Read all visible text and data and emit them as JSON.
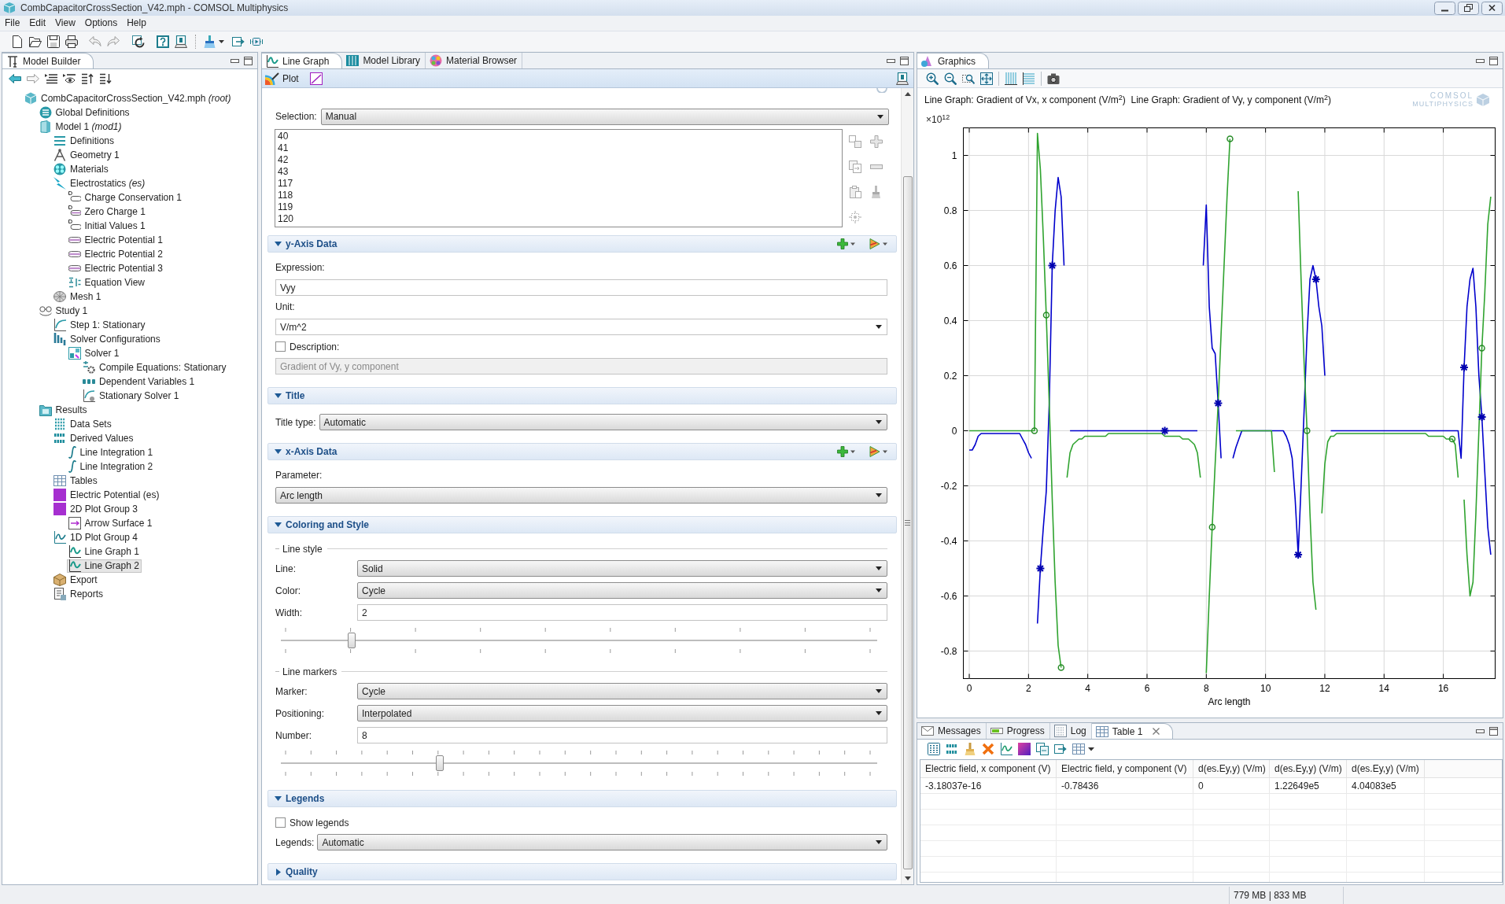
{
  "window": {
    "title": "CombCapacitorCrossSection_V42.mph - COMSOL Multiphysics"
  },
  "menu": [
    "File",
    "Edit",
    "View",
    "Options",
    "Help"
  ],
  "model_builder": {
    "tab": "Model Builder",
    "tree": [
      {
        "label": "CombCapacitorCrossSection_V42.mph *(root)*",
        "kind": "root",
        "selected": false,
        "children": [
          {
            "label": "Global Definitions",
            "kind": "global",
            "selected": false
          },
          {
            "label": "Model 1 *(mod1)*",
            "kind": "model",
            "selected": false,
            "children": [
              {
                "label": "Definitions",
                "kind": "definitions",
                "selected": false
              },
              {
                "label": "Geometry 1",
                "kind": "geometry",
                "selected": false
              },
              {
                "label": "Materials",
                "kind": "materials",
                "selected": false
              },
              {
                "label": "Electrostatics *(es)*",
                "kind": "physics",
                "selected": false,
                "children": [
                  {
                    "label": "Charge Conservation 1",
                    "kind": "feature",
                    "selected": false
                  },
                  {
                    "label": "Zero Charge 1",
                    "kind": "boundary",
                    "selected": false
                  },
                  {
                    "label": "Initial Values 1",
                    "kind": "feature",
                    "selected": false
                  },
                  {
                    "label": "Electric Potential 1",
                    "kind": "potential",
                    "selected": false
                  },
                  {
                    "label": "Electric Potential 2",
                    "kind": "potential",
                    "selected": false
                  },
                  {
                    "label": "Electric Potential 3",
                    "kind": "potential",
                    "selected": false
                  },
                  {
                    "label": "Equation View",
                    "kind": "equation",
                    "selected": false
                  }
                ]
              },
              {
                "label": "Mesh 1",
                "kind": "mesh",
                "selected": false
              }
            ]
          },
          {
            "label": "Study 1",
            "kind": "study",
            "selected": false,
            "children": [
              {
                "label": "Step 1: Stationary",
                "kind": "step",
                "selected": false
              },
              {
                "label": "Solver Configurations",
                "kind": "solvers",
                "selected": false,
                "children": [
                  {
                    "label": "Solver 1",
                    "kind": "solver",
                    "selected": false,
                    "children": [
                      {
                        "label": "Compile Equations: Stationary",
                        "kind": "compile",
                        "selected": false
                      },
                      {
                        "label": "Dependent Variables 1",
                        "kind": "variables",
                        "selected": false
                      },
                      {
                        "label": "Stationary Solver 1",
                        "kind": "stationary",
                        "selected": false
                      }
                    ]
                  }
                ]
              }
            ]
          },
          {
            "label": "Results",
            "kind": "results",
            "selected": false,
            "children": [
              {
                "label": "Data Sets",
                "kind": "datasets",
                "selected": false
              },
              {
                "label": "Derived Values",
                "kind": "derived",
                "selected": false,
                "children": [
                  {
                    "label": "Line Integration 1",
                    "kind": "integration",
                    "selected": false
                  },
                  {
                    "label": "Line Integration 2",
                    "kind": "integration",
                    "selected": false
                  }
                ]
              },
              {
                "label": "Tables",
                "kind": "tables",
                "selected": false
              },
              {
                "label": "Electric Potential (es)",
                "kind": "plot2d",
                "selected": false
              },
              {
                "label": "2D Plot Group 3",
                "kind": "plot2d",
                "selected": false,
                "children": [
                  {
                    "label": "Arrow Surface 1",
                    "kind": "arrow",
                    "selected": false
                  }
                ]
              },
              {
                "label": "1D Plot Group 4",
                "kind": "plot1d",
                "selected": false,
                "children": [
                  {
                    "label": "Line Graph 1",
                    "kind": "linegraph",
                    "selected": false
                  },
                  {
                    "label": "Line Graph 2",
                    "kind": "linegraph",
                    "selected": true
                  }
                ]
              },
              {
                "label": "Export",
                "kind": "export",
                "selected": false
              },
              {
                "label": "Reports",
                "kind": "reports",
                "selected": false
              }
            ]
          }
        ]
      }
    ]
  },
  "settings": {
    "tabs": [
      {
        "label": "Line Graph",
        "kind": "linegraph",
        "selected": true
      },
      {
        "label": "Model Library",
        "kind": "library",
        "selected": false
      },
      {
        "label": "Material Browser",
        "kind": "materials",
        "selected": false
      }
    ],
    "plot_button": "Plot",
    "selection": {
      "label": "Selection:",
      "value": "Manual",
      "items": [
        "40",
        "41",
        "42",
        "43",
        "117",
        "118",
        "119",
        "120"
      ]
    },
    "sections": [
      {
        "title": "y-Axis Data",
        "expanded": true,
        "actions": true,
        "rows": [
          {
            "kind": "label",
            "text": "Expression:"
          },
          {
            "kind": "input",
            "value": "Vyy",
            "disabled": false
          },
          {
            "kind": "label",
            "text": "Unit:"
          },
          {
            "kind": "combo",
            "value": "V/m^2"
          },
          {
            "kind": "checkbox",
            "label": "Description:",
            "checked": false
          },
          {
            "kind": "input",
            "value": "Gradient of Vy, y component",
            "disabled": true
          }
        ]
      },
      {
        "title": "Title",
        "expanded": true,
        "actions": false,
        "rows": [
          {
            "kind": "select",
            "label": "Title type:",
            "value": "Automatic"
          }
        ]
      },
      {
        "title": "x-Axis Data",
        "expanded": true,
        "actions": true,
        "rows": [
          {
            "kind": "label",
            "text": "Parameter:"
          },
          {
            "kind": "select",
            "value": "Arc length"
          }
        ]
      },
      {
        "title": "Coloring and Style",
        "expanded": true,
        "actions": false,
        "rows": [
          {
            "kind": "group",
            "label": "Line style"
          },
          {
            "kind": "form-select",
            "label": "Line:",
            "value": "Solid"
          },
          {
            "kind": "form-select",
            "label": "Color:",
            "value": "Cycle"
          },
          {
            "kind": "form-input",
            "label": "Width:",
            "value": "2"
          },
          {
            "kind": "slider",
            "level": 0.114
          },
          {
            "kind": "group",
            "label": "Line markers"
          },
          {
            "kind": "form-select",
            "label": "Marker:",
            "value": "Cycle"
          },
          {
            "kind": "form-select",
            "label": "Positioning:",
            "value": "Interpolated"
          },
          {
            "kind": "form-input",
            "label": "Number:",
            "value": "8"
          },
          {
            "kind": "fine-slider",
            "level": 0.263
          }
        ]
      },
      {
        "title": "Legends",
        "expanded": true,
        "actions": false,
        "rows": [
          {
            "kind": "checkbox",
            "label": "Show legends",
            "checked": false
          },
          {
            "kind": "select",
            "label": "Legends:",
            "value": "Automatic"
          }
        ]
      },
      {
        "title": "Quality",
        "expanded": false,
        "actions": false
      }
    ]
  },
  "graphics": {
    "tab": "Graphics",
    "logo": {
      "line_1": "COMSOL",
      "line_2": "MULTIPHYSICS"
    },
    "axis_multiplier": "×10$^{12}$",
    "chart_data": {
      "type": "line",
      "title": "Line Graph: Gradient of Vx, x component (V/m$^{2}$)  Line Graph: Gradient of Vy, y component (V/m$^{2}$)",
      "xlabel": "Arc length",
      "grid": true,
      "x": [
        0,
        0.1,
        0.2,
        0.3,
        0.4,
        0.5,
        0.6,
        0.7,
        0.8,
        0.9,
        1,
        1.1,
        1.2,
        1.3,
        1.4,
        1.5,
        1.6,
        1.7,
        1.8,
        1.9,
        2,
        2.1,
        2.2,
        2.3,
        2.4,
        2.5,
        2.6,
        2.7,
        2.8,
        2.9,
        3,
        3.1,
        3.2,
        3.3,
        3.4,
        3.5,
        3.6,
        3.7,
        3.8,
        3.9,
        4,
        4.1,
        4.2,
        4.3,
        4.4,
        4.5,
        4.6,
        4.7,
        4.8,
        4.9,
        5,
        5.1,
        5.2,
        5.3,
        5.4,
        5.5,
        5.6,
        5.7,
        5.8,
        5.9,
        6,
        6.1,
        6.2,
        6.3,
        6.4,
        6.5,
        6.6,
        6.7,
        6.8,
        6.9,
        7,
        7.1,
        7.2,
        7.3,
        7.4,
        7.5,
        7.6,
        7.7,
        7.8,
        7.9,
        8,
        8.1,
        8.2,
        8.3,
        8.4,
        8.5,
        8.6,
        8.7,
        8.8,
        8.9,
        9,
        9.1,
        9.2,
        9.3,
        9.4,
        9.5,
        9.6,
        9.7,
        9.8,
        9.9,
        10,
        10.1,
        10.2,
        10.3,
        10.4,
        10.5,
        10.6,
        10.7,
        10.8,
        10.9,
        11,
        11.1,
        11.2,
        11.3,
        11.4,
        11.5,
        11.6,
        11.7,
        11.8,
        11.9,
        12,
        12.1,
        12.2,
        12.3,
        12.4,
        12.5,
        12.6,
        12.7,
        12.8,
        12.9,
        13,
        13.1,
        13.2,
        13.3,
        13.4,
        13.5,
        13.6,
        13.7,
        13.8,
        13.9,
        14,
        14.1,
        14.2,
        14.3,
        14.4,
        14.5,
        14.6,
        14.7,
        14.8,
        14.9,
        15,
        15.1,
        15.2,
        15.3,
        15.4,
        15.5,
        15.6,
        15.7,
        15.8,
        15.9,
        16,
        16.1,
        16.2,
        16.3,
        16.4,
        16.5,
        16.6,
        16.7,
        16.8,
        16.9,
        17,
        17.1,
        17.2,
        17.3,
        17.4,
        17.5,
        17.6
      ],
      "series": [
        {
          "color": "#0000cc",
          "values": [
            -0.07,
            -0.07,
            -0.05,
            -0.02,
            -0.01,
            -0.01,
            -0.01,
            -0.01,
            -0.01,
            -0.01,
            -0.01,
            -0.01,
            -0.01,
            -0.01,
            -0.01,
            -0.01,
            -0.01,
            -0.01,
            -0.03,
            -0.05,
            -0.08,
            -0.1,
            null,
            -0.7,
            -0.5,
            -0.35,
            -0.22,
            0.1,
            0.6,
            0.8,
            0.92,
            0.85,
            0.6,
            null,
            0,
            0,
            0,
            0,
            0,
            0,
            0,
            0,
            0,
            0,
            0,
            0,
            0,
            0,
            0,
            0,
            0,
            0,
            0,
            0,
            0,
            0,
            0,
            0,
            0,
            0,
            0,
            0,
            0,
            0,
            0,
            0,
            0,
            0,
            0,
            0,
            0,
            0,
            0,
            0,
            0,
            0,
            0,
            0,
            null,
            0.6,
            0.82,
            0.45,
            0.3,
            0.28,
            0.1,
            -0.1,
            null,
            null,
            null,
            -0.1,
            -0.06,
            -0.03,
            0,
            0,
            0,
            0,
            0,
            0,
            0,
            0,
            0,
            0,
            0,
            0,
            0,
            0,
            0,
            -0.02,
            -0.05,
            -0.1,
            -0.25,
            -0.45,
            -0.2,
            0.07,
            0.35,
            0.55,
            0.6,
            0.55,
            0.45,
            0.38,
            0.2,
            null,
            0,
            0,
            0,
            0,
            0,
            0,
            0,
            0,
            0,
            0,
            0,
            0,
            0,
            0,
            0,
            0,
            0,
            0,
            0,
            0,
            0,
            0,
            0,
            0,
            0,
            0,
            0,
            0,
            0,
            0,
            0,
            0,
            0,
            0,
            0,
            0,
            0,
            0,
            0,
            0,
            0,
            0,
            0,
            0,
            -0.1,
            0.23,
            0.45,
            0.55,
            0.59,
            0.45,
            0.2,
            0.05,
            -0.15,
            -0.35,
            -0.45
          ]
        },
        {
          "color": "#2fa32f",
          "values": [
            0,
            0,
            0,
            0,
            0,
            0,
            0,
            0,
            0,
            0,
            0,
            0,
            0,
            0,
            0,
            0,
            0,
            0,
            0,
            0,
            0,
            0,
            0,
            1.08,
            0.95,
            0.7,
            0.42,
            0.1,
            -0.25,
            -0.55,
            -0.78,
            -0.86,
            null,
            -0.17,
            -0.08,
            -0.05,
            -0.04,
            -0.03,
            -0.03,
            -0.02,
            -0.02,
            -0.02,
            -0.02,
            -0.02,
            -0.02,
            -0.02,
            -0.02,
            -0.01,
            -0.01,
            -0.01,
            -0.01,
            -0.01,
            -0.01,
            -0.01,
            -0.01,
            -0.01,
            -0.01,
            -0.01,
            -0.01,
            -0.01,
            -0.01,
            -0.01,
            -0.01,
            -0.01,
            -0.01,
            -0.01,
            -0.02,
            -0.02,
            -0.02,
            -0.02,
            -0.02,
            -0.02,
            -0.03,
            -0.03,
            -0.03,
            -0.04,
            -0.05,
            -0.08,
            -0.17,
            null,
            -0.88,
            -0.6,
            -0.35,
            -0.12,
            0.1,
            0.35,
            0.6,
            0.85,
            1.06,
            null,
            0,
            0,
            0,
            0,
            0,
            0,
            0,
            0,
            0,
            0,
            0,
            0,
            0,
            -0.15,
            null,
            null,
            null,
            null,
            null,
            null,
            null,
            0.87,
            0.55,
            0.25,
            0,
            -0.3,
            -0.55,
            -0.65,
            null,
            -0.3,
            -0.12,
            -0.04,
            -0.02,
            -0.02,
            -0.01,
            -0.01,
            -0.01,
            -0.01,
            -0.01,
            -0.01,
            -0.01,
            -0.01,
            -0.01,
            -0.01,
            -0.01,
            -0.01,
            -0.01,
            -0.01,
            -0.01,
            -0.01,
            -0.01,
            -0.01,
            -0.01,
            -0.01,
            -0.01,
            -0.01,
            -0.01,
            -0.01,
            -0.01,
            -0.01,
            -0.01,
            -0.01,
            -0.01,
            -0.01,
            -0.01,
            -0.02,
            -0.02,
            -0.02,
            -0.02,
            -0.02,
            -0.02,
            -0.03,
            -0.03,
            -0.03,
            -0.05,
            -0.17,
            null,
            -0.25,
            -0.45,
            -0.6,
            -0.55,
            -0.3,
            0,
            0.3,
            0.5,
            0.75,
            0.85
          ]
        }
      ],
      "xlim": [
        -0.2,
        17.75
      ],
      "ylim": [
        -0.9,
        1.1
      ],
      "xticks": [
        0,
        2,
        4,
        6,
        8,
        10,
        12,
        14,
        16
      ],
      "yticks": [
        -0.8,
        -0.6,
        -0.4,
        -0.2,
        0,
        0.2,
        0.4,
        0.6,
        0.8,
        1
      ]
    }
  },
  "messages": {
    "tabs": [
      {
        "label": "Messages",
        "kind": "messages",
        "selected": false,
        "closable": false
      },
      {
        "label": "Progress",
        "kind": "progress",
        "selected": false,
        "closable": false
      },
      {
        "label": "Log",
        "kind": "log",
        "selected": false,
        "closable": false
      },
      {
        "label": "Table 1",
        "kind": "table",
        "selected": true,
        "closable": true
      }
    ],
    "table": {
      "columns": [
        "Electric field, x component (V)",
        "Electric field, y component (V)",
        "d(es.Ey,y) (V/m)",
        "d(es.Ey,y) (V/m)",
        "d(es.Ey,y) (V/m)"
      ],
      "rows": [
        [
          "-3.18037e-16",
          "-0.78436",
          "0",
          "1.22649e5",
          "4.04083e5"
        ]
      ]
    }
  },
  "status_bar": {
    "memory": "779 MB | 833 MB"
  }
}
